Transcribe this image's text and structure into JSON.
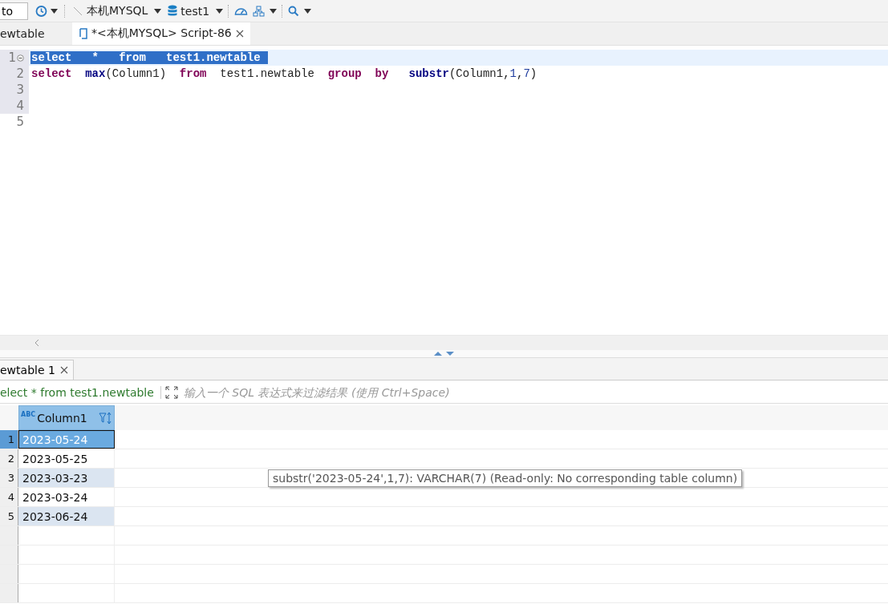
{
  "toolbar": {
    "field_value": "to",
    "connection": "本机MYSQL",
    "database": "test1"
  },
  "editor_tabs": [
    {
      "label": "ewtable",
      "selected": false,
      "modified_icon": false,
      "closable": false
    },
    {
      "label": "*<本机MYSQL> Script-86",
      "selected": true,
      "modified_icon": true,
      "closable": true
    }
  ],
  "editor": {
    "lines": [
      {
        "number": "1",
        "in_block": true,
        "selected": true,
        "foldable": true,
        "tokens": [
          {
            "text": "select   *   from   test1.newtable ",
            "kind": "keyword"
          }
        ]
      },
      {
        "number": "2",
        "in_block": true,
        "selected": false,
        "foldable": false,
        "tokens": [
          {
            "text": "select  ",
            "kind": "keyword"
          },
          {
            "text": "max",
            "kind": "function"
          },
          {
            "text": "(Column1)  ",
            "kind": "plain"
          },
          {
            "text": "from",
            "kind": "keyword"
          },
          {
            "text": "  test1.newtable  ",
            "kind": "plain"
          },
          {
            "text": "group  ",
            "kind": "keyword"
          },
          {
            "text": "by   ",
            "kind": "keyword"
          },
          {
            "text": "substr",
            "kind": "function"
          },
          {
            "text": "(Column1,",
            "kind": "plain"
          },
          {
            "text": "1",
            "kind": "number"
          },
          {
            "text": ",",
            "kind": "plain"
          },
          {
            "text": "7",
            "kind": "number"
          },
          {
            "text": ")",
            "kind": "plain"
          }
        ]
      },
      {
        "number": "3",
        "in_block": true,
        "selected": false,
        "foldable": false
      },
      {
        "number": "4",
        "in_block": true,
        "selected": false,
        "foldable": false
      },
      {
        "number": "5",
        "in_block": false,
        "selected": false,
        "foldable": false
      }
    ]
  },
  "results": {
    "tab": {
      "label": "ewtable 1",
      "closable": true
    },
    "query": "elect * from test1.newtable",
    "filter": {
      "placeholder": "输入一个 SQL 表达式来过滤结果 (使用 Ctrl+Space)"
    },
    "columns": [
      {
        "label": "Column1",
        "type_badge": "ABC"
      }
    ],
    "rows": [
      {
        "number": "1",
        "selected": true,
        "cells": [
          "2023-05-24"
        ]
      },
      {
        "number": "2",
        "selected": false,
        "cells": [
          "2023-05-25"
        ]
      },
      {
        "number": "3",
        "selected": false,
        "cells": [
          "2023-03-23"
        ]
      },
      {
        "number": "4",
        "selected": false,
        "cells": [
          "2023-03-24"
        ]
      },
      {
        "number": "5",
        "selected": false,
        "cells": [
          "2023-06-24"
        ]
      }
    ],
    "tooltip": "substr('2023-05-24',1,7): VARCHAR(7) (Read-only: No corresponding table column)"
  }
}
